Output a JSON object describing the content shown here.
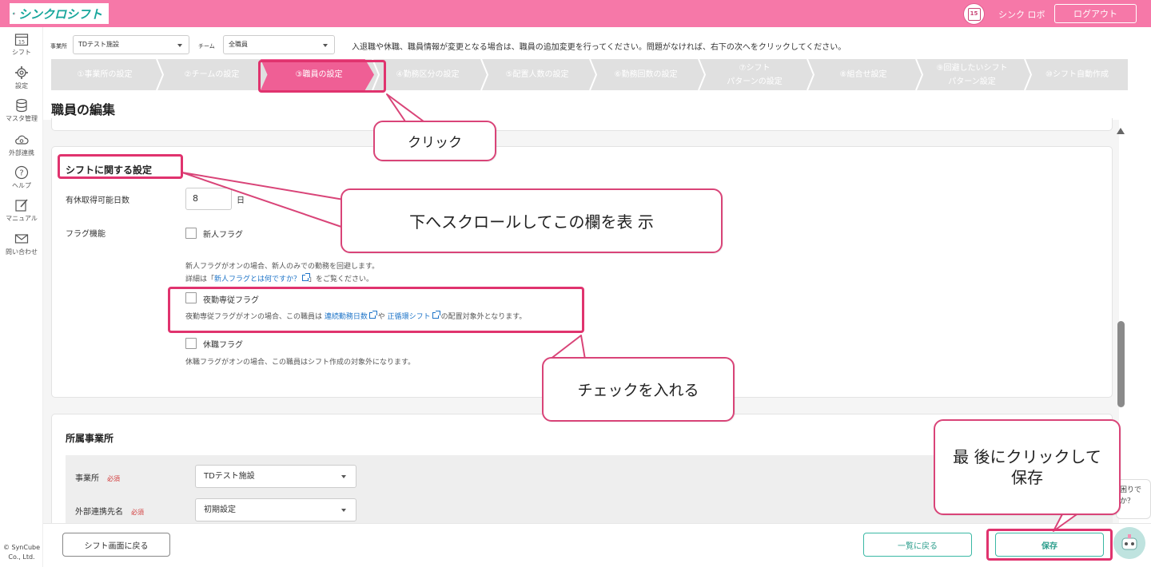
{
  "header": {
    "logo_text": "シンクロシフト",
    "calendar_number": "15",
    "user_name": "シンク ロボ",
    "logout_label": "ログアウト"
  },
  "sidebar": {
    "items": [
      {
        "label": "シフト",
        "icon": "calendar-icon"
      },
      {
        "label": "設定",
        "icon": "gear-icon"
      },
      {
        "label": "マスタ管理",
        "icon": "database-icon"
      },
      {
        "label": "外部連携",
        "icon": "cloud-icon"
      },
      {
        "label": "ヘルプ",
        "icon": "help-icon"
      },
      {
        "label": "マニュアル",
        "icon": "edit-icon"
      },
      {
        "label": "問い合わせ",
        "icon": "mail-icon"
      }
    ],
    "copyright": "© SynCube Co., Ltd."
  },
  "filters": {
    "office_label": "事業所",
    "office_value": "TDテスト施設",
    "team_label": "チーム",
    "team_value": "全職員",
    "notice": "入退職や休職、職員情報が変更となる場合は、職員の追加変更を行ってください。問題がなければ、右下の次へをクリックしてください。"
  },
  "steps": [
    {
      "label": "①事業所の設定"
    },
    {
      "label": "②チームの設定"
    },
    {
      "label": "③職員の設定"
    },
    {
      "label": "④勤務区分の設定"
    },
    {
      "label": "⑤配置人数の設定"
    },
    {
      "label": "⑥勤務回数の設定"
    },
    {
      "label": "⑦シフト\nパターンの設定"
    },
    {
      "label": "⑧組合せ設定"
    },
    {
      "label": "⑨回避したいシフト\nパターン設定"
    },
    {
      "label": "⑩シフト自動作成"
    }
  ],
  "page_title": "職員の編集",
  "shift_section": {
    "title": "シフトに関する設定",
    "paid_leave_label": "有休取得可能日数",
    "paid_leave_value": "8",
    "paid_leave_unit": "日",
    "flag_label": "フラグ機能",
    "new_flag_label": "新人フラグ",
    "new_flag_desc": "新人フラグがオンの場合、新人のみでの勤務を回避します。",
    "detail_prefix": "詳細は「",
    "detail_link": "新人フラグとは何ですか？",
    "detail_suffix": "」をご覧ください。",
    "night_flag_label": "夜勤専従フラグ",
    "night_desc_prefix": "夜勤専従フラグがオンの場合、この職員は",
    "night_link1": "連続勤務日数",
    "night_desc_mid": "や",
    "night_link2": "正循環シフト",
    "night_desc_suffix": "の配置対象外となります。",
    "leave_flag_label": "休職フラグ",
    "leave_flag_desc": "休職フラグがオンの場合、この職員はシフト作成の対象外になります。"
  },
  "office_section": {
    "title": "所属事業所",
    "office_label": "事業所",
    "required": "必須",
    "office_value": "TDテスト施設",
    "ext_label": "外部連携先名",
    "ext_value": "初期設定"
  },
  "buttons": {
    "back_to_shift": "シフト画面に戻る",
    "back_to_list": "一覧に戻る",
    "save": "保存"
  },
  "help_bubble": "困りで\nか？",
  "annotations": {
    "click": "クリック",
    "scroll": "下へスクロールしてこの欄を表 示",
    "check": "チェックを入れる",
    "save_last": "最 後にクリックして\n保存"
  },
  "colors": {
    "header_pink": "#f678a8",
    "highlight": "#e0336e",
    "teal": "#3ab8a4",
    "link": "#1e74c8"
  }
}
